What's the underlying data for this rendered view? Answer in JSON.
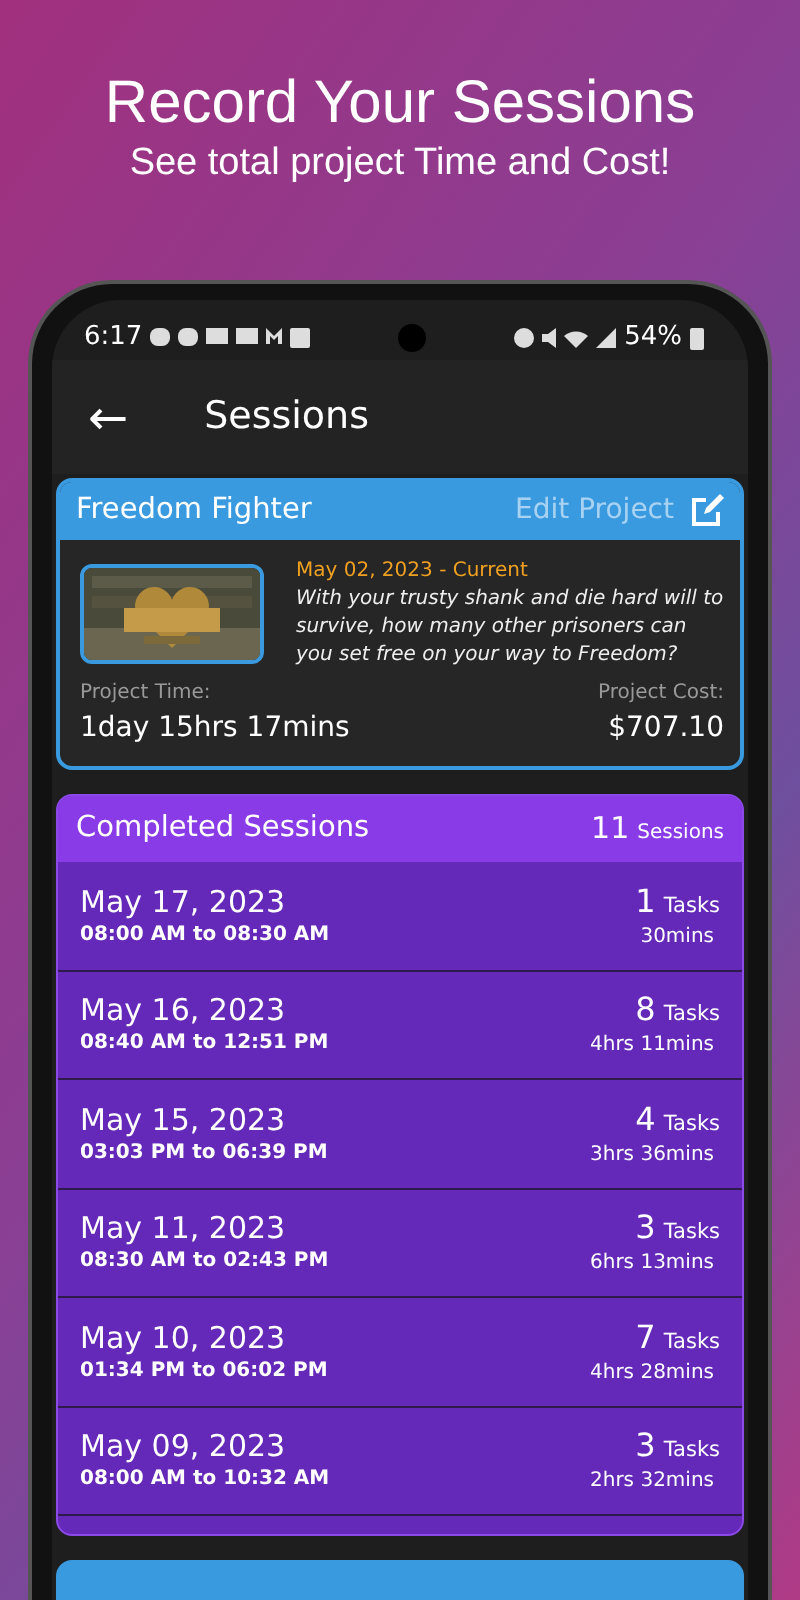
{
  "promo": {
    "headline": "Record Your Sessions",
    "subline": "See total project Time and Cost!"
  },
  "status_bar": {
    "time": "6:17",
    "battery": "54%"
  },
  "app_bar": {
    "back": "←",
    "title": "Sessions"
  },
  "project": {
    "name": "Freedom Fighter",
    "edit_label": "Edit Project",
    "date": "May 02, 2023 - Current",
    "description": "With your trusty shank and die hard will to survive, how many other prisoners can you set free on your way to Freedom?",
    "time_label": "Project Time:",
    "time": "1day 15hrs 17mins",
    "cost_label": "Project Cost:",
    "cost": "$707.10"
  },
  "sessions": {
    "title": "Completed Sessions",
    "count": "11",
    "count_label": "Sessions",
    "rows": [
      {
        "date": "May 17, 2023",
        "range": "08:00 AM to 08:30 AM",
        "tasks": "1",
        "tasks_label": "Tasks",
        "duration": "30mins"
      },
      {
        "date": "May 16, 2023",
        "range": "08:40 AM to 12:51 PM",
        "tasks": "8",
        "tasks_label": "Tasks",
        "duration": "4hrs 11mins"
      },
      {
        "date": "May 15, 2023",
        "range": "03:03 PM to 06:39 PM",
        "tasks": "4",
        "tasks_label": "Tasks",
        "duration": "3hrs 36mins"
      },
      {
        "date": "May 11, 2023",
        "range": "08:30 AM to 02:43 PM",
        "tasks": "3",
        "tasks_label": "Tasks",
        "duration": "6hrs 13mins"
      },
      {
        "date": "May 10, 2023",
        "range": "01:34 PM to 06:02 PM",
        "tasks": "7",
        "tasks_label": "Tasks",
        "duration": "4hrs 28mins"
      },
      {
        "date": "May 09, 2023",
        "range": "08:00 AM to 10:32 AM",
        "tasks": "3",
        "tasks_label": "Tasks",
        "duration": "2hrs 32mins"
      }
    ]
  }
}
